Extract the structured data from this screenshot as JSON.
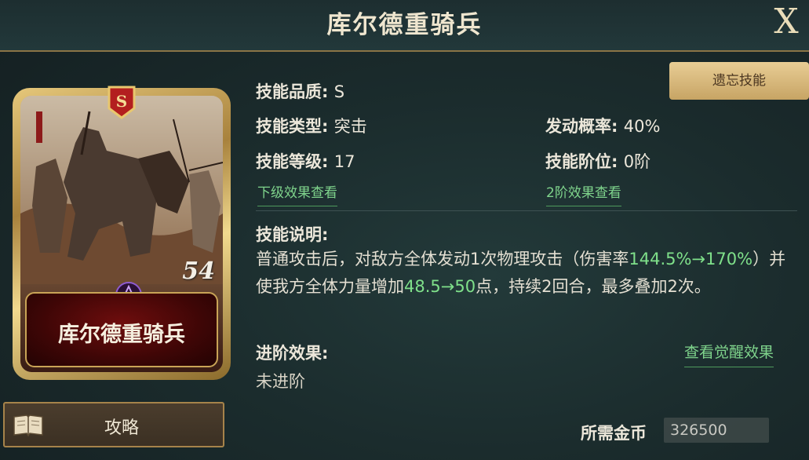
{
  "header": {
    "title": "库尔德重骑兵",
    "close_label": "X"
  },
  "card": {
    "grade_badge": "S",
    "level": "54",
    "name": "库尔德重骑兵"
  },
  "guide_button": {
    "label": "攻略",
    "icon": "book-icon"
  },
  "forget_button": {
    "label": "遗忘技能"
  },
  "skill": {
    "quality_label": "技能品质: ",
    "quality_value": "S",
    "type_label": "技能类型: ",
    "type_value": "突击",
    "level_label": "技能等级: ",
    "level_value": "17",
    "rate_label": "发动概率: ",
    "rate_value": "40%",
    "rank_label": "技能阶位: ",
    "rank_value": "0阶",
    "lower_effect_link": "下级效果查看",
    "rank2_effect_link": "2阶效果查看"
  },
  "description": {
    "title": "技能说明:",
    "part1": "普通攻击后，对敌方全体发动1次物理攻击（伤害率",
    "hl1": "144.5%→170%",
    "part2": "）并使我方全体力量增加",
    "hl2": "48.5→50",
    "part3": "点，持续2回合，最多叠加2次。"
  },
  "advance": {
    "title": "进阶效果:",
    "value": "未进阶",
    "awaken_link": "查看觉醒效果"
  },
  "cost": {
    "label": "所需金币",
    "value": "326500"
  },
  "colors": {
    "accent_green": "#7fe08a",
    "gold": "#c9a456"
  }
}
